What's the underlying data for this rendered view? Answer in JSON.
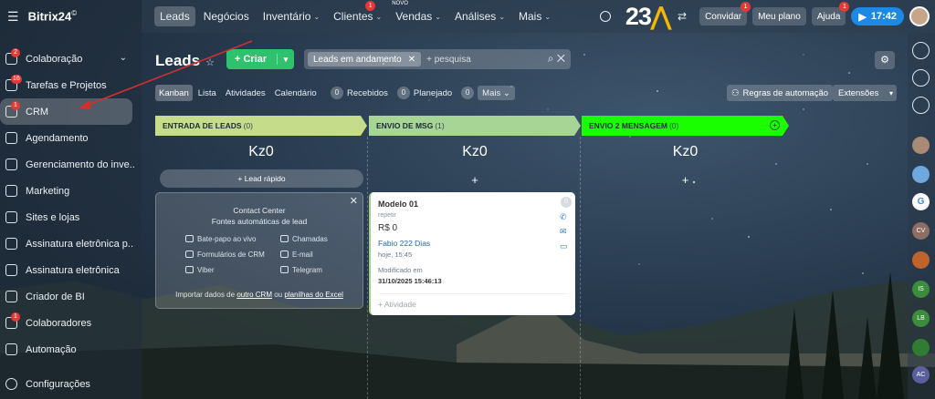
{
  "brand": {
    "name": "Bitrix24",
    "mark": "©"
  },
  "sidebar": {
    "items": [
      {
        "label": "Colaboração",
        "badge": "2",
        "chevron": "⌄"
      },
      {
        "label": "Tarefas e Projetos",
        "badge": "16"
      },
      {
        "label": "CRM",
        "badge": "1",
        "active": true
      },
      {
        "label": "Agendamento"
      },
      {
        "label": "Gerenciamento do inve..."
      },
      {
        "label": "Marketing"
      },
      {
        "label": "Sites e lojas"
      },
      {
        "label": "Assinatura eletrônica p..."
      },
      {
        "label": "Assinatura eletrônica"
      },
      {
        "label": "Criador de BI"
      },
      {
        "label": "Colaboradores",
        "badge": "1"
      },
      {
        "label": "Automação"
      }
    ],
    "settings_label": "Configurações"
  },
  "topbar": {
    "tabs": [
      {
        "label": "Leads",
        "active": true
      },
      {
        "label": "Negócios"
      },
      {
        "label": "Inventário",
        "caret": "⌄"
      },
      {
        "label": "Clientes",
        "caret": "⌄",
        "badge": "1"
      },
      {
        "label": "Vendas",
        "caret": "⌄",
        "tag": "NOVO"
      },
      {
        "label": "Análises",
        "caret": "⌄"
      },
      {
        "label": "Mais",
        "caret": "⌄"
      }
    ],
    "logo_text": "23",
    "invite_label": "Convidar",
    "invite_badge": "1",
    "plan_label": "Meu plano",
    "help_label": "Ajuda",
    "help_badge": "1",
    "time": "17:42"
  },
  "main": {
    "title": "Leads",
    "create_label": "+ Criar",
    "filter_chip": "Leads em andamento",
    "search_placeholder": "+ pesquisa",
    "views": [
      "Kanban",
      "Lista",
      "Atividades",
      "Calendário"
    ],
    "counters": [
      {
        "n": "0",
        "label": "Recebidos"
      },
      {
        "n": "0",
        "label": "Planejado"
      },
      {
        "n": "0",
        "label": "Mais"
      }
    ],
    "automation_label": "Regras de automação",
    "extensions_label": "Extensões"
  },
  "columns": [
    {
      "title": "ENTRADA DE LEADS",
      "count": "(0)",
      "total": "Kz0",
      "color": "#c5dd8a"
    },
    {
      "title": "ENVIO DE MSG",
      "count": "(1)",
      "total": "Kz0",
      "color": "#a6d595"
    },
    {
      "title": "ENVIO 2 MENSAGEM",
      "count": "(0)",
      "total": "Kz0",
      "color": "#1aff00"
    }
  ],
  "quick_lead_label": "+ Lead rápido",
  "contact_center": {
    "title": "Contact Center",
    "subtitle": "Fontes automáticas de lead",
    "options": [
      "Bate-papo ao vivo",
      "Chamadas",
      "Formulários de CRM",
      "E-mail",
      "Viber",
      "Telegram"
    ],
    "import_prefix": "Importar dados de",
    "import_link1": "outro CRM",
    "import_mid": "ou",
    "import_link2": "planilhas do Excel"
  },
  "card": {
    "title": "Modelo 01",
    "repeat": "repetir",
    "price": "R$ 0",
    "contact": "Fabio 222 Dias",
    "date": "hoje, 15:45",
    "modified_label": "Modificado em",
    "modified_value": "31/10/2025 15:46:13",
    "activity": "+ Atividade",
    "badge": "0"
  },
  "rail": [
    "CV",
    "IS",
    "LB",
    "AC"
  ],
  "colors": {
    "accent_green": "#2fc26e",
    "accent_blue": "#1e88e5",
    "badge_red": "#e53935",
    "arrow": "#d32f2f"
  }
}
